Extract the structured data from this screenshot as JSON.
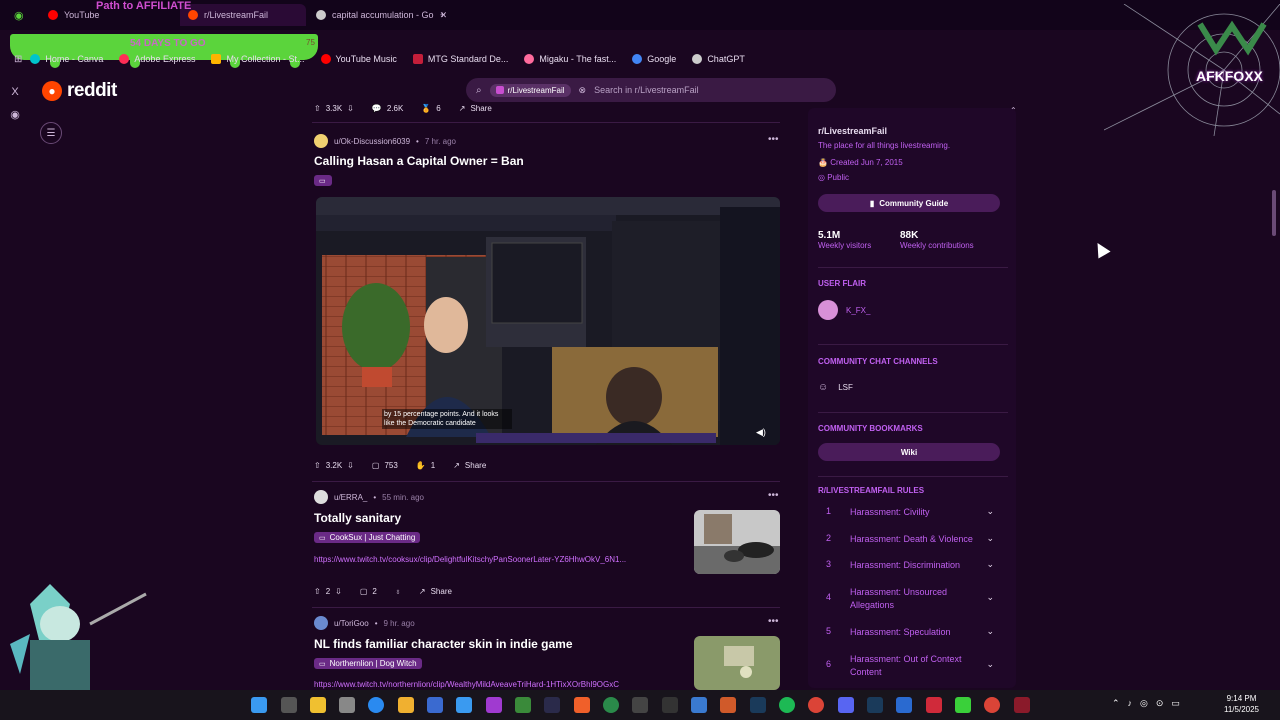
{
  "browser": {
    "tabs": [
      {
        "label": "YouTube",
        "color": "#ff0000"
      },
      {
        "label": "r/LivestreamFail",
        "color": "#ff4500"
      },
      {
        "label": "capital accumulation - Go",
        "color": "#cccccc"
      }
    ],
    "bookmarks": [
      {
        "label": "Home - Canva",
        "color": "#00c4cc"
      },
      {
        "label": "Adobe Express",
        "color": "#ff2d55"
      },
      {
        "label": "My Collection - St...",
        "color": "#ffb400"
      },
      {
        "label": "YouTube Music",
        "color": "#ff0000"
      },
      {
        "label": "MTG Standard De...",
        "color": "#c41e3a"
      },
      {
        "label": "Migaku - The fast...",
        "color": "#ff6b9d"
      },
      {
        "label": "Google",
        "color": "#4285f4"
      },
      {
        "label": "ChatGPT",
        "color": "#cccccc"
      }
    ]
  },
  "overlay": {
    "affiliate": "Path to AFFILIATE",
    "days": "54 DAYS TO GO",
    "count": "75",
    "brand": "AFKFOXX"
  },
  "reddit": {
    "logo": "reddit",
    "search": {
      "chip": "r/LivestreamFail",
      "placeholder": "Search in r/LivestreamFail"
    }
  },
  "feed": {
    "prev_actions": {
      "votes": "3.3K",
      "comments": "2.6K",
      "awards": "6",
      "share": "Share"
    },
    "posts": [
      {
        "author": "u/Ok-Discussion6039",
        "time": "7 hr. ago",
        "title": "Calling Hasan a Capital Owner = Ban",
        "caption": "by 15 percentage points. And it looks like the Democratic candidate",
        "votes": "3.2K",
        "comments": "753",
        "awards": "1",
        "share": "Share",
        "avatar_color": "#f0d070"
      },
      {
        "author": "u/ERRA_",
        "time": "55 min. ago",
        "title": "Totally sanitary",
        "flair": "CookSux | Just Chatting",
        "link": "https://www.twitch.tv/cooksux/clip/DelightfulKitschyPanSoonerLater-YZ6HhwOkV_6N1...",
        "votes": "2",
        "comments": "2",
        "share": "Share",
        "avatar_color": "#dddddd"
      },
      {
        "author": "u/ToriGoo",
        "time": "9 hr. ago",
        "title": "NL finds familiar character skin in indie game",
        "flair": "Northernlion | Dog Witch",
        "link": "https://www.twitch.tv/northernlion/clip/WealthyMildAveaveTriHard-1HTixXOrBhl9OGxC",
        "avatar_color": "#6a8ad0"
      }
    ]
  },
  "sidebar": {
    "name": "r/LivestreamFail",
    "description": "The place for all things livestreaming.",
    "created": "Created Jun 7, 2015",
    "visibility": "Public",
    "guide_button": "Community Guide",
    "stats": [
      {
        "value": "5.1M",
        "label": "Weekly visitors"
      },
      {
        "value": "88K",
        "label": "Weekly contributions"
      }
    ],
    "user_flair_head": "USER FLAIR",
    "user_flair": "K_FX_",
    "chat_head": "COMMUNITY CHAT CHANNELS",
    "chat_channel": "LSF",
    "bookmarks_head": "COMMUNITY BOOKMARKS",
    "wiki": "Wiki",
    "rules_head": "R/LIVESTREAMFAIL RULES",
    "rules": [
      {
        "n": "1",
        "text": "Harassment: Civility"
      },
      {
        "n": "2",
        "text": "Harassment: Death & Violence"
      },
      {
        "n": "3",
        "text": "Harassment: Discrimination"
      },
      {
        "n": "4",
        "text": "Harassment: Unsourced Allegations"
      },
      {
        "n": "5",
        "text": "Harassment: Speculation"
      },
      {
        "n": "6",
        "text": "Harassment: Out of Context Content"
      }
    ]
  },
  "taskbar": {
    "time": "9:14 PM",
    "date": "11/5/2025"
  }
}
